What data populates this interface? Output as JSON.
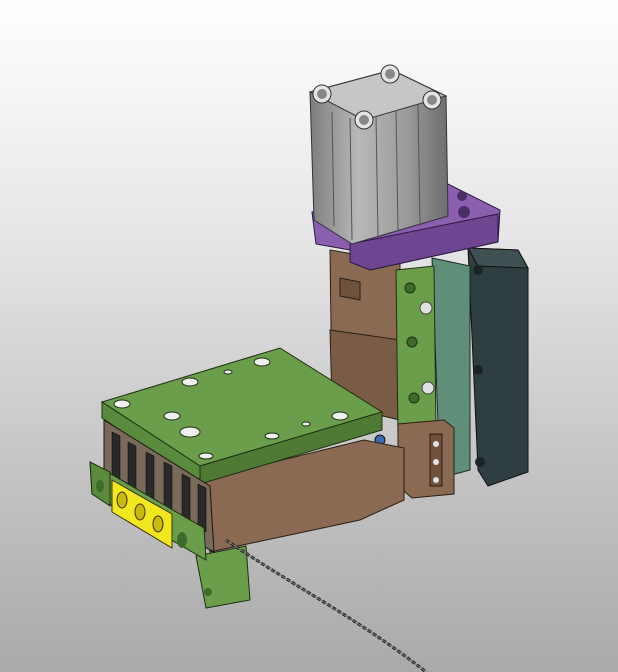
{
  "scene": {
    "colors": {
      "background_top": "#ffffff",
      "background_bottom": "#a9a9a9",
      "plate_green": "#6a9e4a",
      "body_brown": "#8a6a52",
      "cylinder_gray": "#9a9a9a",
      "bracket_purple": "#8a5fb0",
      "side_plate_dark": "#2f3e40",
      "teal_plate": "#5f8f7a",
      "yellow_block": "#f2e61e",
      "cable": "#222222"
    }
  }
}
